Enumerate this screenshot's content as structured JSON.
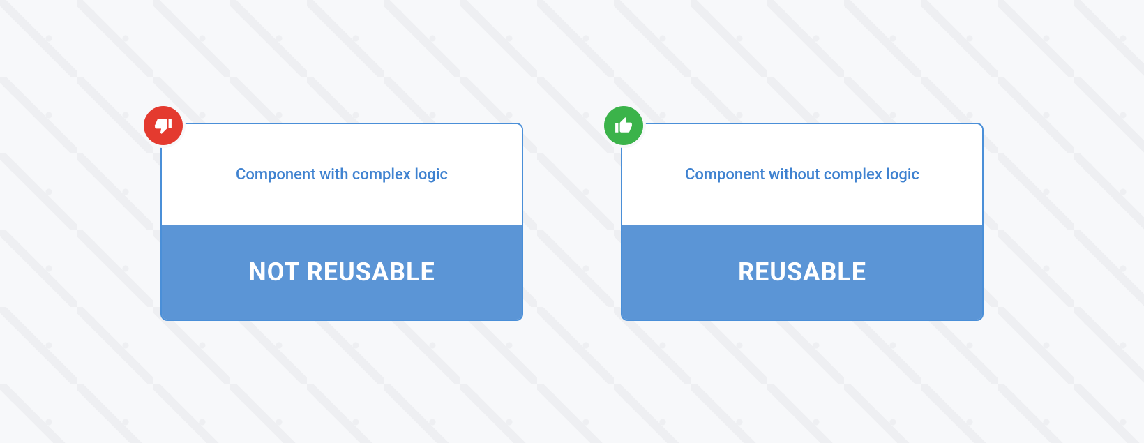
{
  "colors": {
    "blue_border": "#4a8fd8",
    "blue_fill": "#5b95d6",
    "title_text": "#3f82d0",
    "red": "#e43a2f",
    "green": "#3bb34a",
    "white": "#ffffff"
  },
  "cards": {
    "left": {
      "title": "Component with complex logic",
      "status": "NOT REUSABLE",
      "badge_color": "#e43a2f",
      "icon": "thumb-down-icon"
    },
    "right": {
      "title": "Component without complex logic",
      "status": "REUSABLE",
      "badge_color": "#3bb34a",
      "icon": "thumb-up-icon"
    }
  }
}
